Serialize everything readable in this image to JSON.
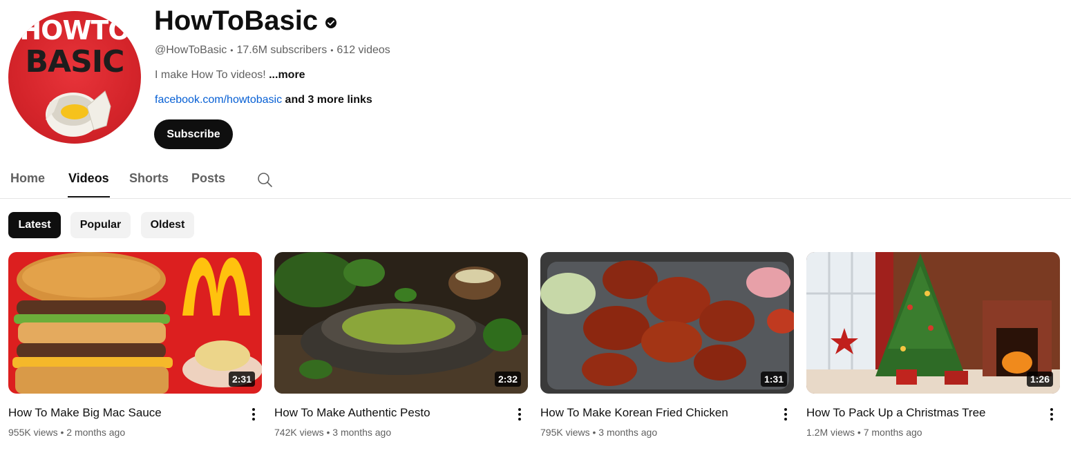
{
  "channel": {
    "avatar_text_line1": "HOWTO",
    "avatar_text_line2": "BASIC",
    "name": "HowToBasic",
    "verified_icon": "verified-check-icon",
    "handle": "@HowToBasic",
    "subscribers": "17.6M subscribers",
    "videos_count": "612 videos",
    "separator": "•",
    "description": "I make How To videos! ",
    "description_more": "...more",
    "link": "facebook.com/howtobasic",
    "link_extra": " and 3 more links",
    "subscribe_label": "Subscribe"
  },
  "tabs": [
    {
      "label": "Home"
    },
    {
      "label": "Videos",
      "active": true
    },
    {
      "label": "Shorts"
    },
    {
      "label": "Posts"
    }
  ],
  "search_icon": "search-icon",
  "chips": [
    {
      "label": "Latest",
      "active": true
    },
    {
      "label": "Popular"
    },
    {
      "label": "Oldest"
    }
  ],
  "videos": [
    {
      "title": "How To Make Big Mac Sauce",
      "views": "955K views",
      "age": "2 months ago",
      "duration": "2:31"
    },
    {
      "title": "How To Make Authentic Pesto",
      "views": "742K views",
      "age": "3 months ago",
      "duration": "2:32"
    },
    {
      "title": "How To Make Korean Fried Chicken",
      "views": "795K views",
      "age": "3 months ago",
      "duration": "1:31"
    },
    {
      "title": "How To Pack Up a Christmas Tree",
      "views": "1.2M views",
      "age": "7 months ago",
      "duration": "1:26"
    }
  ],
  "colors": {
    "accent": "#0f0f0f",
    "link": "#065fd4",
    "brand_red": "#d4242a"
  }
}
